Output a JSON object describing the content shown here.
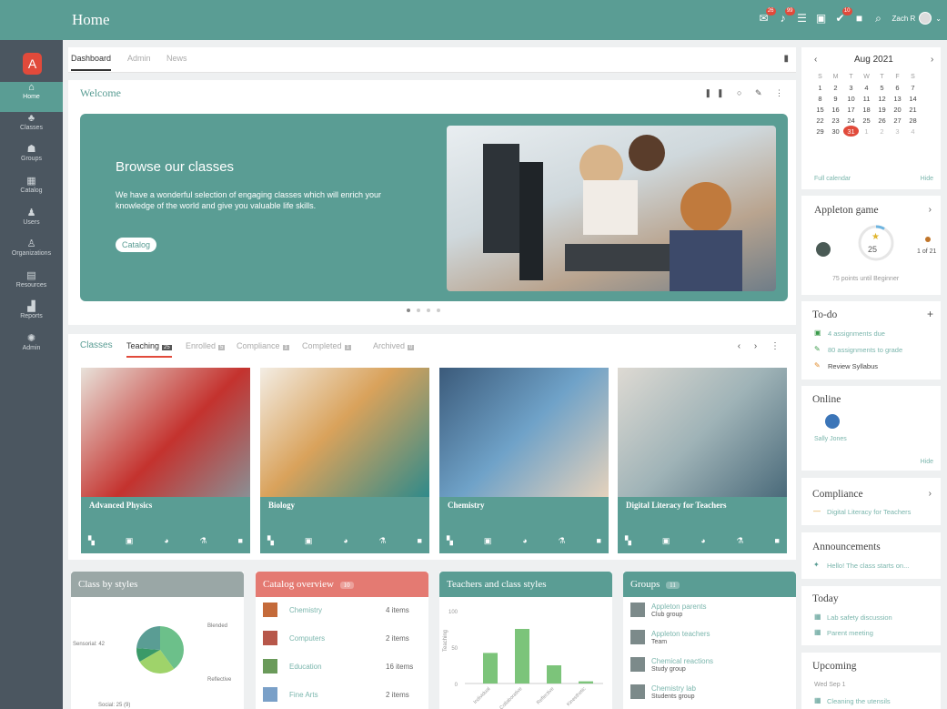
{
  "topbar": {
    "title": "Home",
    "badges": [
      "26",
      "99",
      "10"
    ],
    "user": "Zach R"
  },
  "sidebar": {
    "logo": "A",
    "items": [
      {
        "label": "Home",
        "icon": "home-icon",
        "glyph": "⌂"
      },
      {
        "label": "Classes",
        "icon": "classes-icon",
        "glyph": "♣"
      },
      {
        "label": "Groups",
        "icon": "groups-icon",
        "glyph": "☗"
      },
      {
        "label": "Catalog",
        "icon": "catalog-icon",
        "glyph": "▦"
      },
      {
        "label": "Users",
        "icon": "users-icon",
        "glyph": "♟"
      },
      {
        "label": "Organizations",
        "icon": "organizations-icon",
        "glyph": "♙"
      },
      {
        "label": "Resources",
        "icon": "resources-icon",
        "glyph": "▤"
      },
      {
        "label": "Reports",
        "icon": "reports-icon",
        "glyph": "▟"
      },
      {
        "label": "Admin",
        "icon": "admin-icon",
        "glyph": "✺"
      }
    ]
  },
  "tabs": [
    "Dashboard",
    "Admin",
    "News"
  ],
  "welcome": {
    "title": "Welcome",
    "hero_title": "Browse our classes",
    "hero_text": "We have a wonderful selection of engaging classes which will enrich your knowledge of the world and give you valuable life skills.",
    "hero_button": "Catalog"
  },
  "classes": {
    "title": "Classes",
    "tabs": [
      {
        "label": "Teaching",
        "count": "25"
      },
      {
        "label": "Enrolled",
        "count": "5"
      },
      {
        "label": "Compliance",
        "count": "1"
      },
      {
        "label": "Completed",
        "count": "1"
      },
      {
        "label": "Archived",
        "count": "0"
      }
    ],
    "cards": [
      "Advanced Physics",
      "Biology",
      "Chemistry",
      "Digital Literacy for Teachers"
    ]
  },
  "widgets": {
    "styles": {
      "title": "Class by styles",
      "labels": [
        "Sensorial: 42",
        "Blended",
        "Reflective",
        "Social: 25 (9)"
      ]
    },
    "catalog": {
      "title": "Catalog overview",
      "count": "10",
      "rows": [
        {
          "name": "Chemistry",
          "count": "4 items"
        },
        {
          "name": "Computers",
          "count": "2 items"
        },
        {
          "name": "Education",
          "count": "16 items"
        },
        {
          "name": "Fine Arts",
          "count": "2 items"
        }
      ]
    },
    "teachers": {
      "title": "Teachers and class styles",
      "ylabel": "Teaching",
      "yticks": [
        "100",
        "50",
        "0"
      ],
      "xlabels": [
        "Individual",
        "Collaborative",
        "Reflective",
        "Kinesthetic"
      ]
    },
    "groups": {
      "title": "Groups",
      "count": "11",
      "rows": [
        {
          "name": "Appleton parents",
          "type": "Club group"
        },
        {
          "name": "Appleton teachers",
          "type": "Team"
        },
        {
          "name": "Chemical reactions",
          "type": "Study group"
        },
        {
          "name": "Chemistry lab",
          "type": "Students group"
        }
      ]
    }
  },
  "chart_data": [
    {
      "type": "pie",
      "title": "Class by styles",
      "categories": [
        "Sensorial",
        "Blended",
        "Reflective",
        "Social"
      ],
      "values": [
        42,
        28,
        10,
        25
      ]
    },
    {
      "type": "bar",
      "title": "Teachers and class styles",
      "ylabel": "Teaching",
      "categories": [
        "Individual",
        "Collaborative",
        "Reflective",
        "Kinesthetic"
      ],
      "values": [
        42,
        75,
        25,
        3
      ],
      "ylim": [
        0,
        100
      ]
    }
  ],
  "calendar": {
    "month": "Aug 2021",
    "days": [
      "S",
      "M",
      "T",
      "W",
      "T",
      "F",
      "S"
    ],
    "weeks": [
      [
        "1",
        "2",
        "3",
        "4",
        "5",
        "6",
        "7"
      ],
      [
        "8",
        "9",
        "10",
        "11",
        "12",
        "13",
        "14"
      ],
      [
        "15",
        "16",
        "17",
        "18",
        "19",
        "20",
        "21"
      ],
      [
        "22",
        "23",
        "24",
        "25",
        "26",
        "27",
        "28"
      ],
      [
        "29",
        "30",
        "31",
        "1",
        "2",
        "3",
        "4"
      ]
    ],
    "today": "31",
    "footer_left": "Full calendar",
    "footer_right": "Hide"
  },
  "game": {
    "title": "Appleton game",
    "points": "25",
    "rank": "1 of 21",
    "caption": "75 points until Beginner"
  },
  "todo": {
    "title": "To-do",
    "items": [
      "4 assignments due",
      "80 assignments to grade",
      "Review Syllabus"
    ]
  },
  "online": {
    "title": "Online",
    "user": "Sally Jones",
    "link": "Hide"
  },
  "compliance": {
    "title": "Compliance",
    "item": "Digital Literacy for Teachers"
  },
  "announcements": {
    "title": "Announcements",
    "item": "Hello! The class starts on..."
  },
  "today": {
    "title": "Today",
    "items": [
      "Lab safety discussion",
      "Parent meeting"
    ]
  },
  "upcoming": {
    "title": "Upcoming",
    "date": "Wed Sep 1",
    "item": "Cleaning the utensils"
  },
  "colors": {
    "teal": "#5a9d94",
    "sidebar": "#4b5660",
    "red": "#e47a72",
    "grey": "#9aa7a6"
  }
}
